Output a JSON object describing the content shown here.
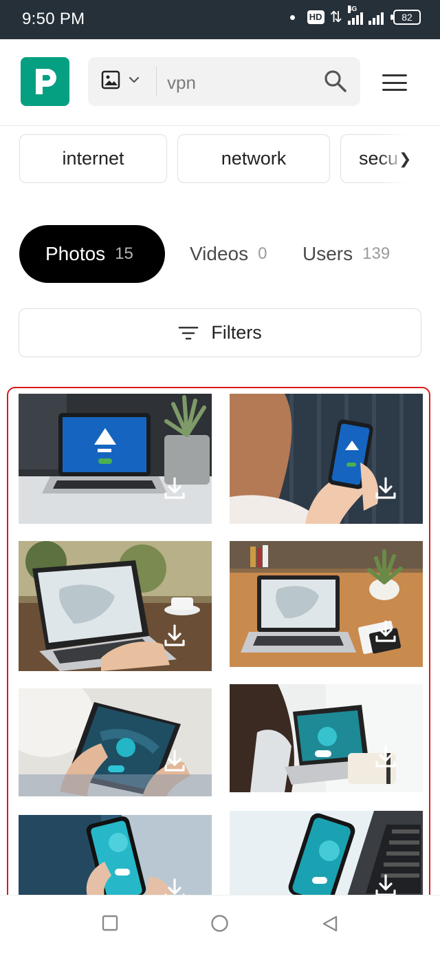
{
  "status_bar": {
    "time": "9:50 PM",
    "hd_label": "HD",
    "network_label": "4G",
    "battery": "82"
  },
  "header": {
    "logo_letter": "P",
    "logo_color": "#05a081",
    "search": {
      "media_type_icon": "image-icon",
      "query": "vpn"
    }
  },
  "related_tags": [
    "internet",
    "network",
    "secu"
  ],
  "tabs": [
    {
      "label": "Photos",
      "count": "15",
      "active": true
    },
    {
      "label": "Videos",
      "count": "0",
      "active": false
    },
    {
      "label": "Users",
      "count": "139",
      "active": false
    }
  ],
  "filters": {
    "label": "Filters"
  },
  "grid_outline_color": "#d51919",
  "photos": [
    {
      "subject": "laptop-vpn-screen",
      "icon": "download-icon"
    },
    {
      "subject": "hand-holding-phone-vpn",
      "icon": "download-icon"
    },
    {
      "subject": "laptop-map-coffee",
      "icon": "download-icon"
    },
    {
      "subject": "laptop-map-desk-plant",
      "icon": "download-icon"
    },
    {
      "subject": "tablet-vpn-map",
      "icon": "download-icon"
    },
    {
      "subject": "woman-laptop-vpn",
      "icon": "download-icon"
    },
    {
      "subject": "phone-vpn-hand",
      "icon": "download-icon"
    },
    {
      "subject": "phone-vpn-laptop",
      "icon": "download-icon"
    }
  ]
}
